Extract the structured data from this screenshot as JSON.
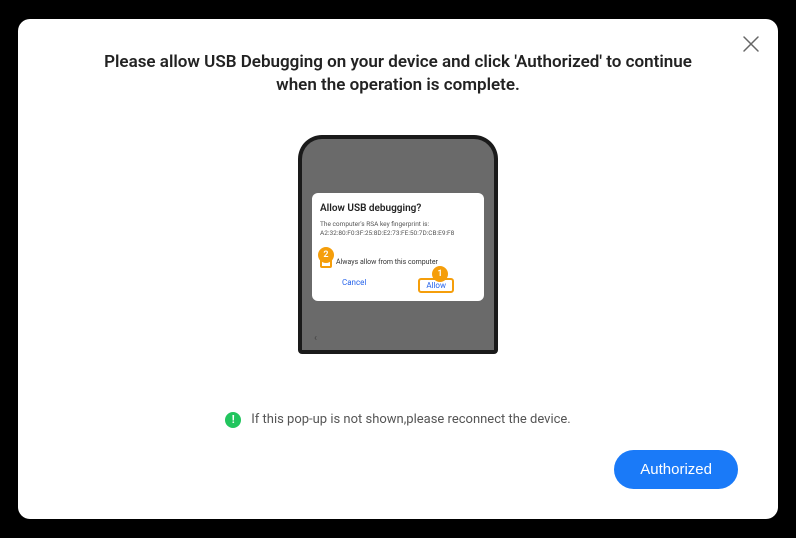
{
  "modal": {
    "title": "Please allow USB Debugging on your device and click 'Authorized' to continue when the operation is complete."
  },
  "phone_dialog": {
    "title": "Allow USB debugging?",
    "subtitle1": "The computer's RSA key fingerprint is:",
    "subtitle2": "A2:32:80:F0:3F:25:8D:E2:73:FE:50:7D:CB:E9:F8",
    "checkbox_label": "Always allow from this computer",
    "cancel": "Cancel",
    "allow": "Allow"
  },
  "steps": {
    "s1": "1",
    "s2": "2"
  },
  "hint": {
    "icon": "!",
    "text": "If this pop-up is not shown,please reconnect the device."
  },
  "buttons": {
    "authorized": "Authorized"
  }
}
